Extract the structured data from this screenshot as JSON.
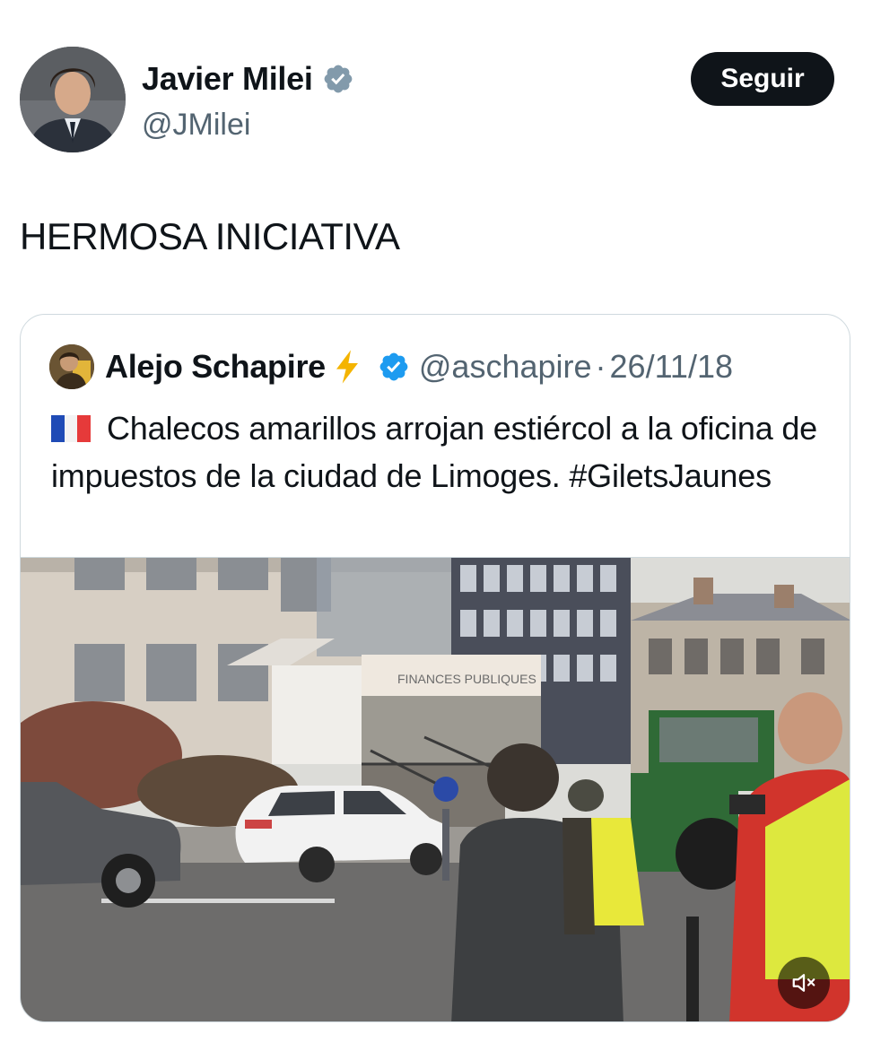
{
  "tweet": {
    "author": {
      "display_name": "Javier Milei",
      "handle": "@JMilei",
      "verified": true,
      "avatar_icon": "profile-photo"
    },
    "follow_label": "Seguir",
    "text": "HERMOSA INICIATIVA"
  },
  "quoted_tweet": {
    "author": {
      "display_name": "Alejo Schapire",
      "badge_icon": "lightning-bolt-icon",
      "verified": true,
      "handle": "@aschapire",
      "avatar_icon": "profile-photo"
    },
    "separator": "·",
    "date": "26/11/18",
    "flag_icon": "france-flag-icon",
    "text": "Chalecos amarillos arrojan estiércol a la oficina de impuestos de la ciudad de Limoges. #GiletsJaunes",
    "media": {
      "type": "video",
      "scene_sign_text": "FINANCES PUBLIQUES",
      "mute_icon": "speaker-muted-icon"
    }
  },
  "colors": {
    "text_primary": "#0f1419",
    "text_secondary": "#536471",
    "verified_blue": "#1d9bf0",
    "verified_gray": "#829aab",
    "follow_bg": "#0f1419",
    "card_border": "#cfd9de",
    "bolt_yellow": "#f4b400"
  }
}
